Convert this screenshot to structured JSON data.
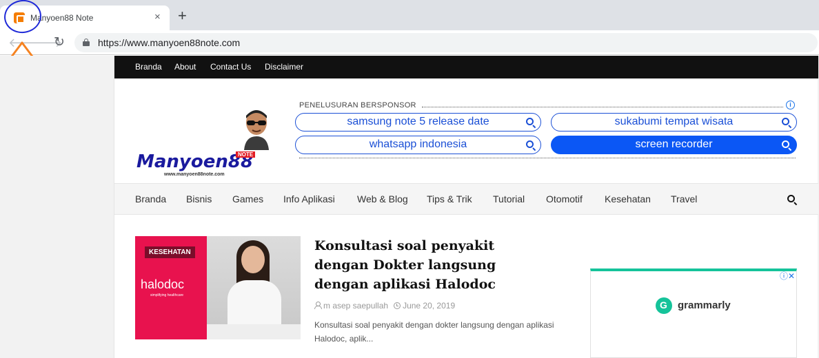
{
  "browser": {
    "tab_title": "Manyoen88 Note",
    "close_glyph": "×",
    "newtab_glyph": "+",
    "back_glyph": "🡐",
    "forward_glyph": "🡒",
    "reload_glyph": "↻",
    "url": "https://www.manyoen88note.com"
  },
  "topbar": {
    "links": [
      "Branda",
      "About",
      "Contact Us",
      "Disclaimer"
    ]
  },
  "logo": {
    "text": "Manyoen88",
    "badge": "NOTE",
    "url": "www.manyoen88note.com"
  },
  "sponsored": {
    "label": "PENELUSURAN BERSPONSOR",
    "info_glyph": "i",
    "queries": [
      "samsung note 5 release date",
      "sukabumi tempat wisata",
      "whatsapp indonesia",
      "screen recorder"
    ]
  },
  "mainnav": {
    "items": [
      "Branda",
      "Bisnis",
      "Games",
      "Info Aplikasi",
      "Web & Blog",
      "Tips & Trik",
      "Tutorial",
      "Otomotif",
      "Kesehatan",
      "Travel"
    ]
  },
  "article": {
    "category": "KESEHATAN",
    "thumb_brand": "halodoc",
    "thumb_tagline": "simplifying healthcare",
    "title": "Konsultasi soal penyakit dengan Dokter langsung dengan aplikasi Halodoc",
    "author": "m asep saepullah",
    "date": "June 20, 2019",
    "excerpt": "Konsultasi soal penyakit dengan dokter langsung dengan aplikasi Halodoc, aplik..."
  },
  "ad": {
    "controls": "ⓘ✕",
    "brand": "grammarly"
  },
  "colors": {
    "annotation_circle": "#1f2ad8",
    "annotation_arrow": "#f58220",
    "accent_blue": "#0b57f5",
    "topbar_bg": "#111111",
    "category_badge": "#7a0d2a",
    "grammarly_green": "#15c39a"
  }
}
